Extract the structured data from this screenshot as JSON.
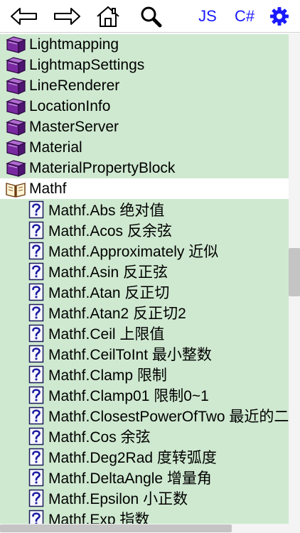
{
  "toolbar": {
    "js_label": "JS",
    "cs_label": "C#",
    "accent_color": "#1a1aff",
    "icons": [
      "back-arrow-icon",
      "forward-arrow-icon",
      "home-icon",
      "search-icon",
      "gear-icon"
    ]
  },
  "class_items": [
    {
      "label": "Lightmapping",
      "icon": "class-book-icon"
    },
    {
      "label": "LightmapSettings",
      "icon": "class-book-icon"
    },
    {
      "label": "LineRenderer",
      "icon": "class-book-icon"
    },
    {
      "label": "LocationInfo",
      "icon": "class-book-icon"
    },
    {
      "label": "MasterServer",
      "icon": "class-book-icon"
    },
    {
      "label": "Material",
      "icon": "class-book-icon"
    },
    {
      "label": "MaterialPropertyBlock",
      "icon": "class-book-icon"
    },
    {
      "label": "Mathf",
      "icon": "open-book-icon"
    }
  ],
  "member_items": [
    {
      "label": "Mathf.Abs 绝对值",
      "icon": "help-page-icon"
    },
    {
      "label": "Mathf.Acos 反余弦",
      "icon": "help-page-icon"
    },
    {
      "label": "Mathf.Approximately 近似",
      "icon": "help-page-icon"
    },
    {
      "label": "Mathf.Asin 反正弦",
      "icon": "help-page-icon"
    },
    {
      "label": "Mathf.Atan 反正切",
      "icon": "help-page-icon"
    },
    {
      "label": "Mathf.Atan2 反正切2",
      "icon": "help-page-icon"
    },
    {
      "label": "Mathf.Ceil 上限值",
      "icon": "help-page-icon"
    },
    {
      "label": "Mathf.CeilToInt 最小整数",
      "icon": "help-page-icon"
    },
    {
      "label": "Mathf.Clamp 限制",
      "icon": "help-page-icon"
    },
    {
      "label": "Mathf.Clamp01 限制0~1",
      "icon": "help-page-icon"
    },
    {
      "label": "Mathf.ClosestPowerOfTwo 最近的二",
      "icon": "help-page-icon"
    },
    {
      "label": "Mathf.Cos 余弦",
      "icon": "help-page-icon"
    },
    {
      "label": "Mathf.Deg2Rad 度转弧度",
      "icon": "help-page-icon"
    },
    {
      "label": "Mathf.DeltaAngle 增量角",
      "icon": "help-page-icon"
    },
    {
      "label": "Mathf.Epsilon 小正数",
      "icon": "help-page-icon"
    },
    {
      "label": "Mathf.Exp 指数",
      "icon": "help-page-icon"
    }
  ],
  "colors": {
    "row_bg": "#cfe9d0",
    "scroll_thumb": "#c4c4c4"
  }
}
